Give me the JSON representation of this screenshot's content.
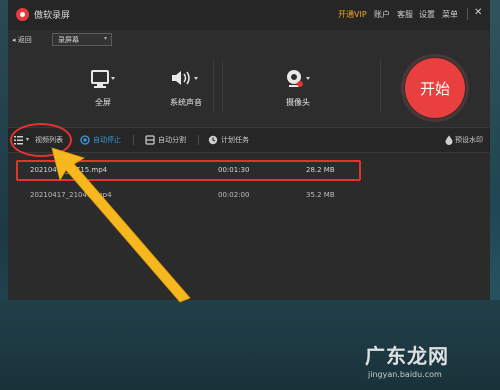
{
  "app": {
    "title": "傲软录屏",
    "menu": {
      "vip": "开通VIP",
      "account": "账户",
      "service": "客服",
      "settings": "设置",
      "menu": "菜单"
    },
    "close_glyph": "✕"
  },
  "nav": {
    "back": "◂ 返回",
    "mode": "录屏幕",
    "mode_chevron": "▾"
  },
  "controls": [
    {
      "label": "全屏",
      "icon": "monitor-icon"
    },
    {
      "label": "系统声音",
      "icon": "speaker-icon"
    },
    {
      "label": "摄像头",
      "icon": "webcam-icon"
    }
  ],
  "start_button": "开始",
  "toolbar": {
    "video_list": "视频列表",
    "auto_stop": "自动停止",
    "auto_split": "自动分割",
    "schedule": "计划任务",
    "watermark": "预设水印"
  },
  "files": [
    {
      "name": "20210417_2  715.mp4",
      "duration": "00:01:30",
      "size": "28.2 MB",
      "selected": true
    },
    {
      "name": "20210417_21049  .mp4",
      "duration": "00:02:00",
      "size": "35.2 MB",
      "selected": false
    }
  ],
  "colors": {
    "accent": "#ea3f3f",
    "vip": "#f2a51c",
    "active_tool": "#3b9ae0",
    "annotation": "#e3332f",
    "arrow": "#f6b81e"
  },
  "watermark_logo": {
    "text": "广东龙网",
    "url": "jingyan.baidu.com"
  }
}
